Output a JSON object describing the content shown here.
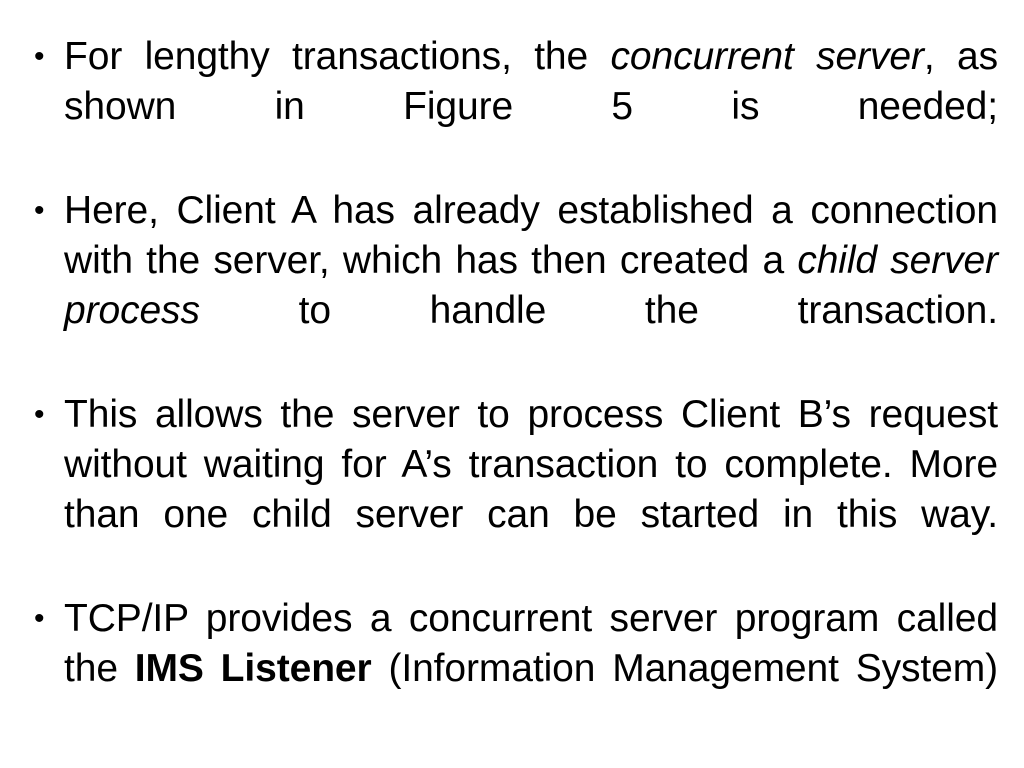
{
  "slide": {
    "background_color": "#ffffff",
    "text_color": "#000000",
    "bullet_glyph": "•",
    "bullets": [
      {
        "id": "bullet-concurrent-server",
        "marker": "•",
        "segments": [
          {
            "text": "For lengthy transactions, the ",
            "style": "normal"
          },
          {
            "text": "concurrent server",
            "style": "italic"
          },
          {
            "text": ", as shown in Figure 5 is needed;",
            "style": "normal"
          }
        ],
        "plain_text": "For lengthy transactions, the concurrent server, as shown in Figure 5 is needed;"
      },
      {
        "id": "bullet-client-a-connection",
        "marker": "•",
        "segments": [
          {
            "text": "Here, Client A has already established a connection with the server, which has then created a ",
            "style": "normal"
          },
          {
            "text": "child server process",
            "style": "italic"
          },
          {
            "text": " to handle the transaction.",
            "style": "normal"
          }
        ],
        "plain_text": "Here, Client A has already established a connection with the server, which has then created a child server process to handle the transaction."
      },
      {
        "id": "bullet-client-b-request",
        "marker": "•",
        "segments": [
          {
            "text": "This allows the server to process Client B’s request without waiting for A’s transaction to complete. More than one child server can be started in this way.",
            "style": "normal"
          }
        ],
        "plain_text": "This allows the server to process Client B’s request without waiting for A’s transaction to complete. More than one child server can be started in this way."
      },
      {
        "id": "bullet-ims-listener",
        "marker": "•",
        "segments": [
          {
            "text": "TCP/IP provides a concurrent server program called the ",
            "style": "normal"
          },
          {
            "text": "IMS Listener",
            "style": "bold"
          },
          {
            "text": " (Information Management System)",
            "style": "normal"
          }
        ],
        "plain_text": "TCP/IP provides a concurrent server program called the IMS Listener (Information Management System)"
      }
    ]
  }
}
